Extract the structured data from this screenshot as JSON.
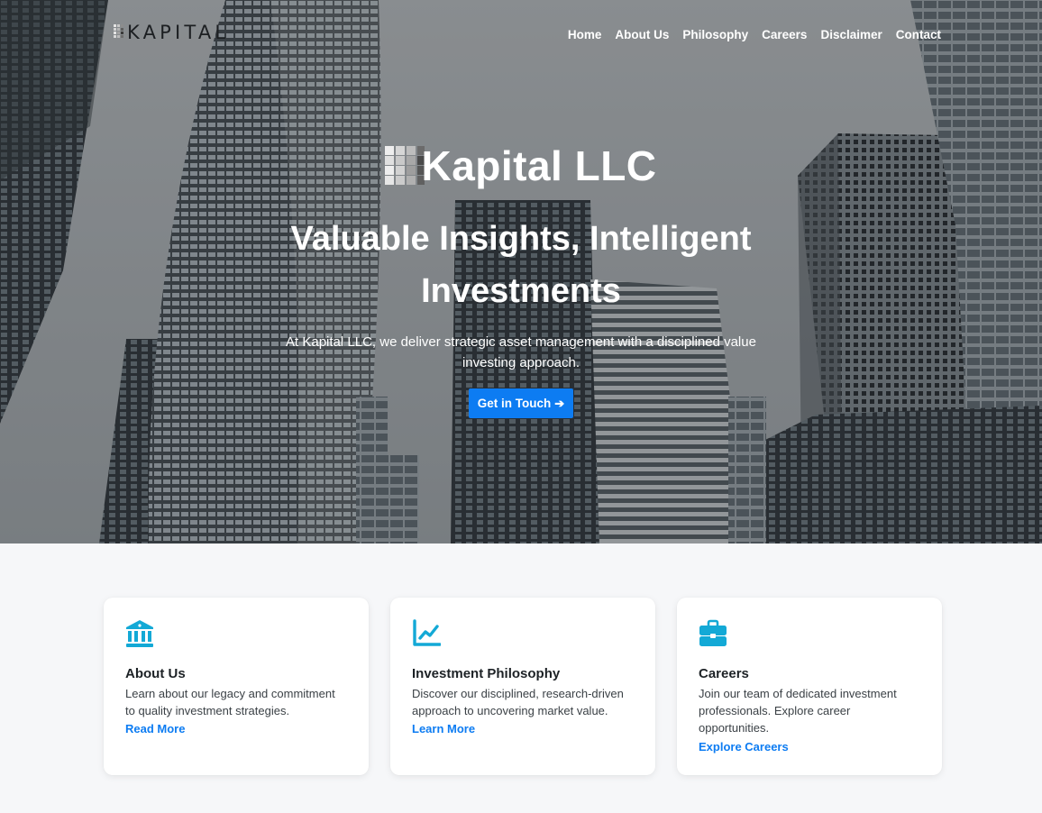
{
  "colors": {
    "accent": "#0d7cf2",
    "icon": "#13a9d6",
    "page_background": "#f6f7f9"
  },
  "nav": {
    "logo_text": "KAPITAL",
    "items": [
      {
        "label": "Home"
      },
      {
        "label": "About Us"
      },
      {
        "label": "Philosophy"
      },
      {
        "label": "Careers"
      },
      {
        "label": "Disclaimer"
      },
      {
        "label": "Contact"
      }
    ]
  },
  "hero": {
    "brand": "Kapital LLC",
    "headline": "Valuable Insights, Intelligent Investments",
    "subhead": "At Kapital LLC, we deliver strategic asset management with a disciplined value investing approach.",
    "cta_label": "Get in Touch",
    "cta_icon": "arrow-right-icon"
  },
  "cards": [
    {
      "icon": "bank-icon",
      "title": "About Us",
      "text": "Learn about our legacy and commitment to quality investment strategies.",
      "link": "Read More"
    },
    {
      "icon": "chart-line-icon",
      "title": "Investment Philosophy",
      "text": "Discover our disciplined, research-driven approach to uncovering market value.",
      "link": "Learn More"
    },
    {
      "icon": "briefcase-icon",
      "title": "Careers",
      "text": "Join our team of dedicated investment professionals. Explore career opportunities.",
      "link": "Explore Careers"
    }
  ]
}
